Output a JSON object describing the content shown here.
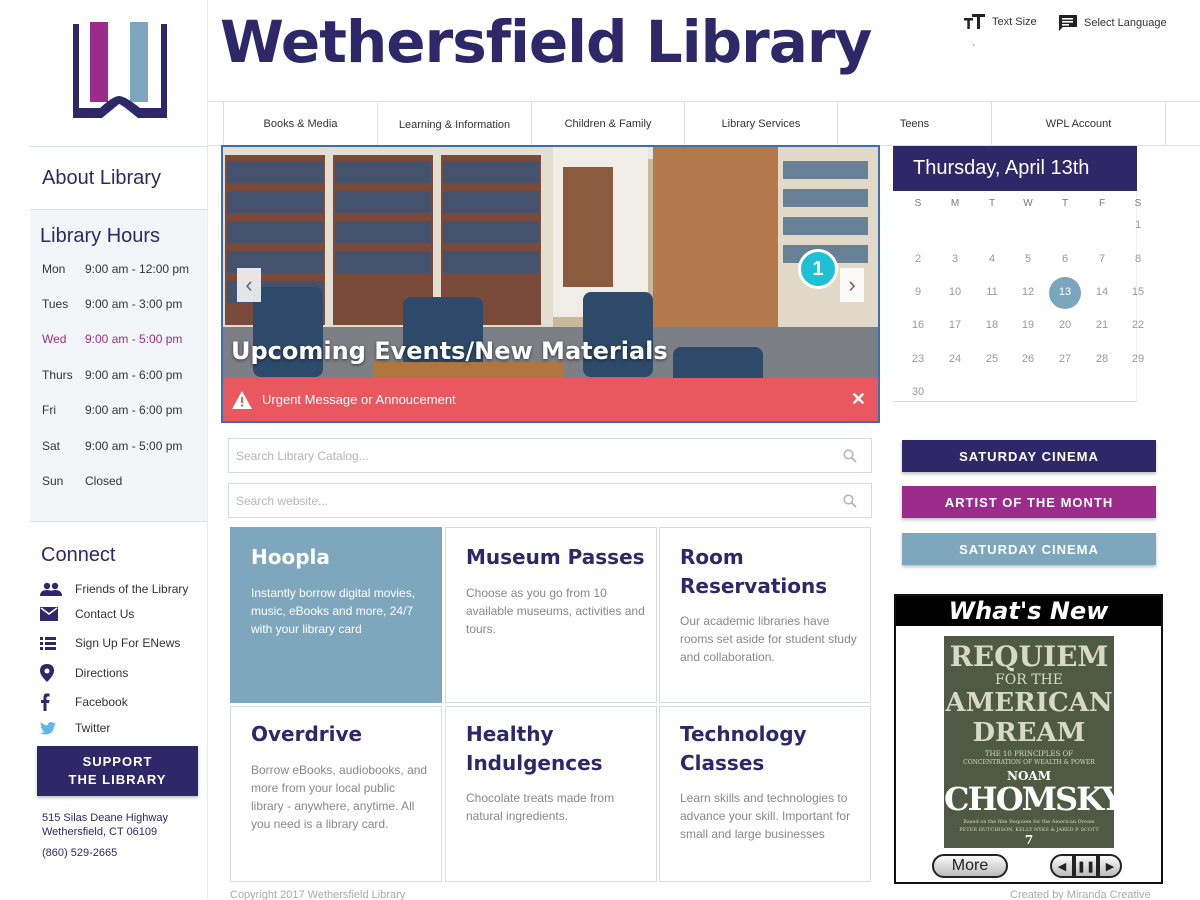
{
  "site": {
    "title": "Wethersfield Library"
  },
  "utility": {
    "text_size": "Text Size",
    "select_language": "Select Language",
    "tick": "`"
  },
  "nav": [
    {
      "label": "Books & Media"
    },
    {
      "label": "Learning & Information"
    },
    {
      "label": "Children & Family"
    },
    {
      "label": "Library Services"
    },
    {
      "label": "Teens"
    },
    {
      "label": "WPL Account"
    }
  ],
  "sidebar": {
    "about": "About Library",
    "hours_title": "Library Hours",
    "hours": [
      {
        "day": "Mon",
        "time": "9:00 am - 12:00 pm"
      },
      {
        "day": "Tues",
        "time": "9:00 am - 3:00 pm"
      },
      {
        "day": "Wed",
        "time": "9:00 am - 5:00 pm"
      },
      {
        "day": "Thurs",
        "time": "9:00 am - 6:00 pm"
      },
      {
        "day": "Fri",
        "time": "9:00 am - 6:00 pm"
      },
      {
        "day": "Sat",
        "time": "9:00 am - 5:00 pm"
      },
      {
        "day": "Sun",
        "time": "Closed"
      }
    ],
    "connect_title": "Connect",
    "connect": [
      {
        "label": "Friends of the Library",
        "icon": "people-icon"
      },
      {
        "label": "Contact Us",
        "icon": "envelope-icon"
      },
      {
        "label": "Sign Up For ENews",
        "icon": "list-icon"
      },
      {
        "label": "Directions",
        "icon": "map-pin-icon"
      },
      {
        "label": "Facebook",
        "icon": "facebook-icon"
      },
      {
        "label": "Twitter",
        "icon": "twitter-icon"
      }
    ],
    "support_line1": "SUPPORT",
    "support_line2": "THE LIBRARY",
    "address1": "515 Silas Deane Highway",
    "address2": "Wethersfield, CT 06109",
    "phone": "(860) 529-2665"
  },
  "hero": {
    "caption": "Upcoming Events/New Materials",
    "slide_number": "1",
    "alert": "Urgent Message or Annoucement",
    "close": "✕",
    "prev": "‹",
    "next": "›"
  },
  "calendar": {
    "header": "Thursday, April 13th",
    "days_of_week": [
      "S",
      "M",
      "T",
      "W",
      "T",
      "F",
      "S"
    ],
    "weeks": [
      [
        "",
        "",
        "",
        "",
        "",
        "",
        "1"
      ],
      [
        "2",
        "3",
        "4",
        "5",
        "6",
        "7",
        "8"
      ],
      [
        "9",
        "10",
        "11",
        "12",
        "13",
        "14",
        "15"
      ],
      [
        "16",
        "17",
        "18",
        "19",
        "20",
        "21",
        "22"
      ],
      [
        "23",
        "24",
        "25",
        "26",
        "27",
        "28",
        "29"
      ],
      [
        "30",
        "",
        "",
        "",
        "",
        "",
        ""
      ]
    ],
    "selected": "13"
  },
  "features": [
    {
      "label": "SATURDAY CINEMA",
      "color": "#2e2869"
    },
    {
      "label": "ARTIST OF THE MONTH",
      "color": "#9c2c8c"
    },
    {
      "label": "SATURDAY CINEMA",
      "color": "#7ea7be"
    }
  ],
  "whats_new": {
    "title": "What's New",
    "cover_title1": "REQUIEM",
    "cover_title2": "FOR THE",
    "cover_title3": "AMERICAN",
    "cover_title4": "DREAM",
    "cover_subtitle1": "THE 10 PRINCIPLES OF",
    "cover_subtitle2": "CONCENTRATION OF WEALTH & POWER",
    "cover_author1": "NOAM",
    "cover_author2": "CHOMSKY",
    "cover_note": "Based on the film Requiem for the American Dream",
    "cover_editors": "PETER HUTCHISON, KELLY NYKS & JARED P. SCOTT",
    "cover_number": "7",
    "more": "More",
    "prev": "◀",
    "pause": "❚❚",
    "next": "▶"
  },
  "search": {
    "catalog_placeholder": "Search Library Catalog...",
    "website_placeholder": "Search website..."
  },
  "tiles": [
    {
      "title": "Hoopla",
      "desc": "Instantly borrow digital movies, music, eBooks and more, 24/7 with your library card"
    },
    {
      "title": "Museum Passes",
      "desc": "Choose as you go from 10 available museums, activities and tours."
    },
    {
      "title": "Room Reservations",
      "desc": "Our academic libraries have rooms set aside for student study and collaboration."
    },
    {
      "title": "Overdrive",
      "desc": "Borrow eBooks, audiobooks, and more from your local public library - anywhere, anytime. All you need is a library card."
    },
    {
      "title": "Healthy Indulgences",
      "desc": "Chocolate treats made from natural ingredients."
    },
    {
      "title": "Technology Classes",
      "desc": "Learn skills and technologies to advance your skill. Important for small and large businesses"
    }
  ],
  "footer": {
    "copyright": "Copyright 2017 Wethersfield Library",
    "credit": "Created by Miranda Creative"
  },
  "colors": {
    "brand": "#2e2869",
    "accent": "#9c2c8c",
    "light_blue": "#7ea7be",
    "alert": "#e9575f",
    "slide_badge": "#1fc0d3"
  }
}
